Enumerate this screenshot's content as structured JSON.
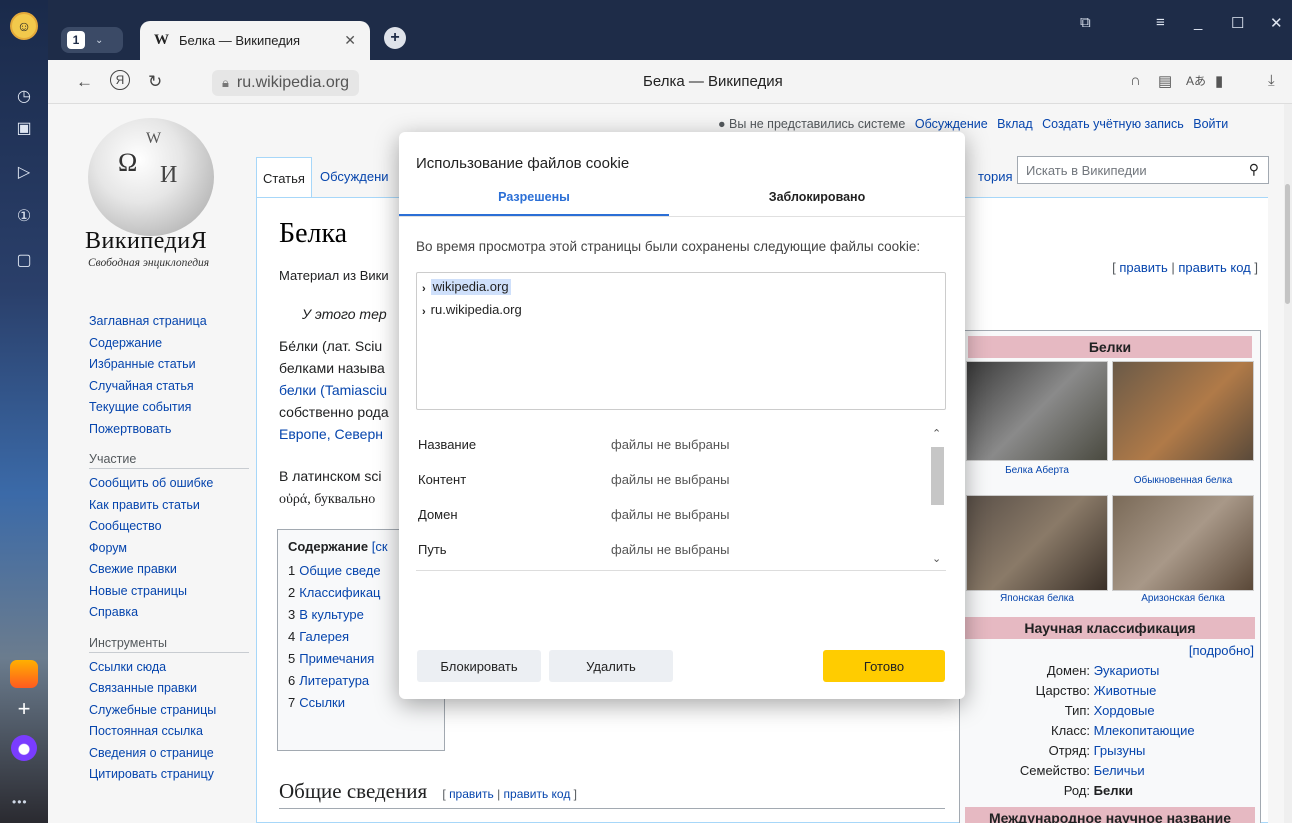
{
  "browser": {
    "tab_count": "1",
    "tab_title": "Белка — Википедия",
    "tab_logo": "W",
    "url": "ru.wikipedia.org",
    "page_title": "Белка — Википедия"
  },
  "wiki": {
    "logo_title": "ВикипедиЯ",
    "logo_subtitle": "Свободная энциклопедия",
    "nav_main": [
      "Заглавная страница",
      "Содержание",
      "Избранные статьи",
      "Случайная статья",
      "Текущие события",
      "Пожертвовать"
    ],
    "nav_participation_heading": "Участие",
    "nav_participation": [
      "Сообщить об ошибке",
      "Как править статьи",
      "Сообщество",
      "Форум",
      "Свежие правки",
      "Новые страницы",
      "Справка"
    ],
    "nav_tools_heading": "Инструменты",
    "nav_tools": [
      "Ссылки сюда",
      "Связанные правки",
      "Служебные страницы",
      "Постоянная ссылка",
      "Сведения о странице",
      "Цитировать страницу"
    ],
    "personal": {
      "not_logged": "Вы не представились системе",
      "talk": "Обсуждение",
      "contrib": "Вклад",
      "create": "Создать учётную запись",
      "login": "Войти"
    },
    "tabs": {
      "article": "Статья",
      "talk": "Обсуждени",
      "history": "тория"
    },
    "search_placeholder": "Искать в Википедии",
    "article_title": "Белка",
    "edit": "править",
    "edit_code": "править код",
    "lines": [
      "Материал из Вики",
      "У этого тер",
      "Бе́лки (лат. Sciu",
      "белками называ",
      "белки (Tamiasciu",
      "собственно рода",
      "Европе, Северн",
      "В латинском sci",
      "οὐρά, буквально"
    ],
    "toc": {
      "title": "Содержание",
      "toggle": "[ск",
      "items": [
        {
          "n": "1",
          "t": "Общие сведе"
        },
        {
          "n": "2",
          "t": "Классификац"
        },
        {
          "n": "3",
          "t": "В культуре"
        },
        {
          "n": "4",
          "t": "Галерея"
        },
        {
          "n": "5",
          "t": "Примечания"
        },
        {
          "n": "6",
          "t": "Литература"
        },
        {
          "n": "7",
          "t": "Ссылки"
        }
      ]
    },
    "section_heading": "Общие сведения",
    "infobox": {
      "title": "Белки",
      "captions": [
        "Белка Аберта",
        "Обыкновенная белка",
        "Японская белка",
        "Аризонская белка"
      ],
      "classification": "Научная классификация",
      "more": "[подробно]",
      "rows": [
        {
          "k": "Домен:",
          "v": "Эукариоты"
        },
        {
          "k": "Царство:",
          "v": "Животные"
        },
        {
          "k": "Тип:",
          "v": "Хордовые"
        },
        {
          "k": "Класс:",
          "v": "Млекопитающие"
        },
        {
          "k": "Отряд:",
          "v": "Грызуны"
        },
        {
          "k": "Семейство:",
          "v": "Беличьи"
        },
        {
          "k": "Род:",
          "v": "Белки"
        }
      ],
      "intl_name": "Международное научное название"
    }
  },
  "cookie_dialog": {
    "title": "Использование файлов cookie",
    "tab_allowed": "Разрешены",
    "tab_blocked": "Заблокировано",
    "description": "Во время просмотра этой страницы были сохранены следующие файлы cookie:",
    "sites": [
      "wikipedia.org",
      "ru.wikipedia.org"
    ],
    "details": [
      {
        "k": "Название",
        "v": "файлы не выбраны"
      },
      {
        "k": "Контент",
        "v": "файлы не выбраны"
      },
      {
        "k": "Домен",
        "v": "файлы не выбраны"
      },
      {
        "k": "Путь",
        "v": "файлы не выбраны"
      }
    ],
    "btn_block": "Блокировать",
    "btn_delete": "Удалить",
    "btn_done": "Готово"
  }
}
